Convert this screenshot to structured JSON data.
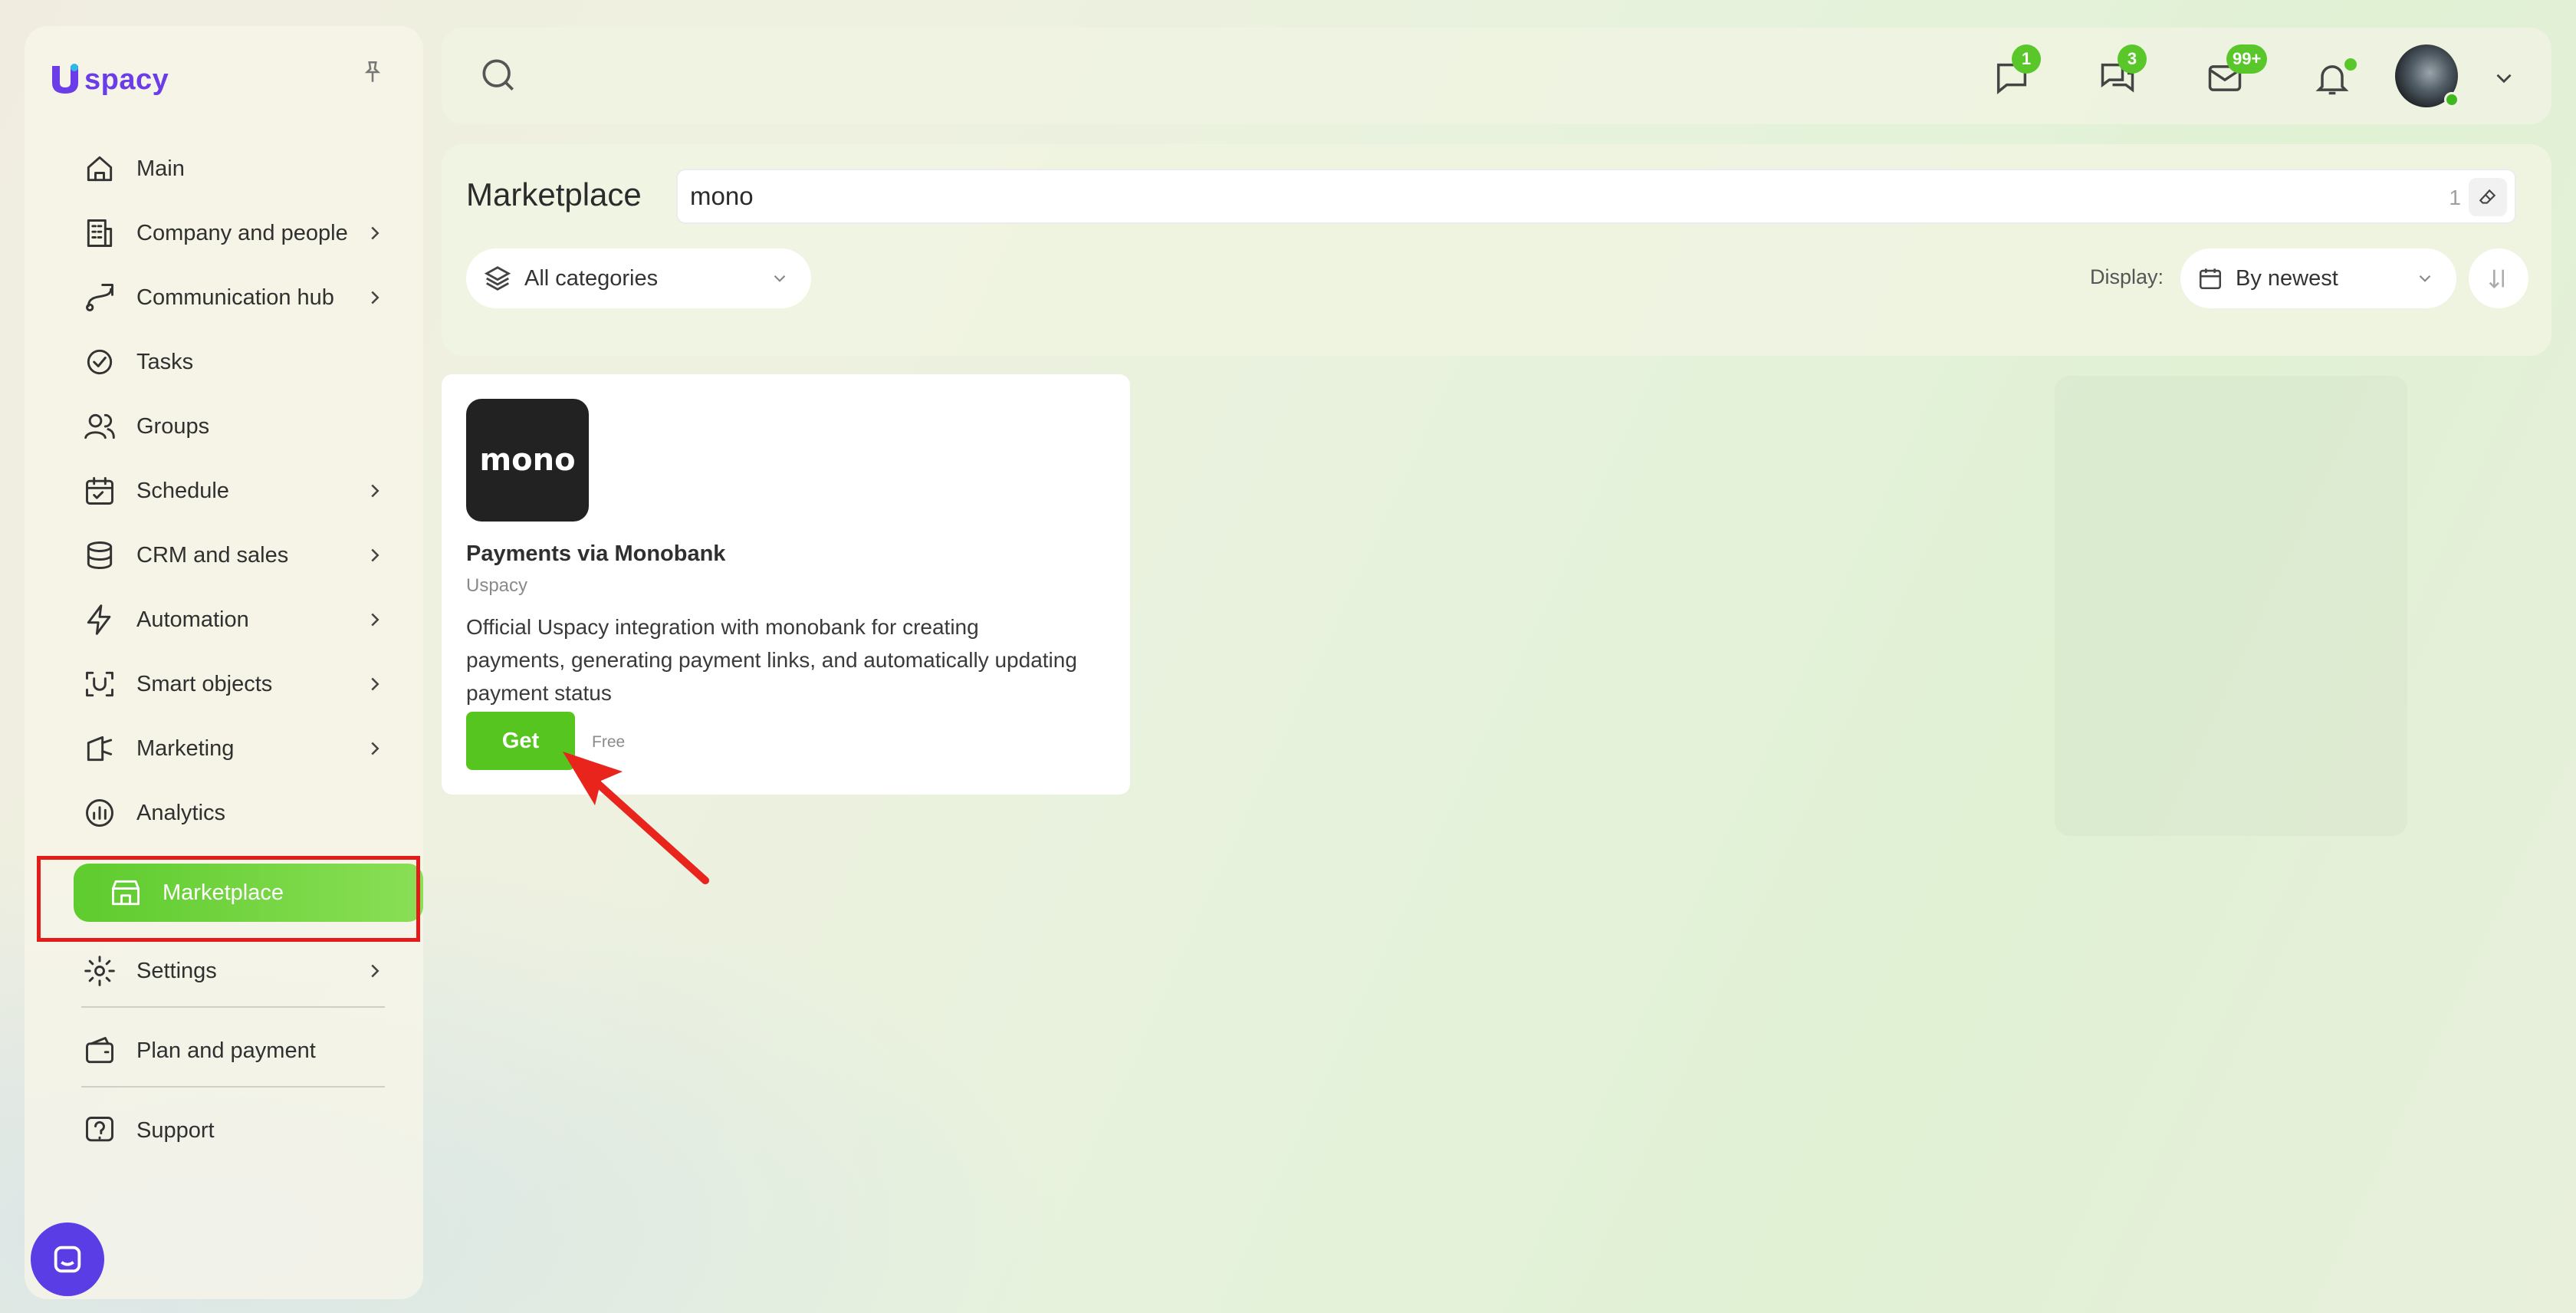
{
  "brand": {
    "name": "spacy",
    "color": "#6a3de8"
  },
  "sidebar": {
    "items": [
      {
        "label": "Main",
        "icon": "home-icon",
        "has_submenu": false
      },
      {
        "label": "Company and people",
        "icon": "building-icon",
        "has_submenu": true
      },
      {
        "label": "Communication hub",
        "icon": "chat-path-icon",
        "has_submenu": true
      },
      {
        "label": "Tasks",
        "icon": "task-check-icon",
        "has_submenu": false
      },
      {
        "label": "Groups",
        "icon": "users-icon",
        "has_submenu": false
      },
      {
        "label": "Schedule",
        "icon": "calendar-icon",
        "has_submenu": true
      },
      {
        "label": "CRM and sales",
        "icon": "database-icon",
        "has_submenu": true
      },
      {
        "label": "Automation",
        "icon": "lightning-icon",
        "has_submenu": true
      },
      {
        "label": "Smart objects",
        "icon": "scan-icon",
        "has_submenu": true
      },
      {
        "label": "Marketing",
        "icon": "marketing-icon",
        "has_submenu": true
      },
      {
        "label": "Analytics",
        "icon": "analytics-icon",
        "has_submenu": false
      },
      {
        "label": "Marketplace",
        "icon": "store-icon",
        "has_submenu": false,
        "active": true
      },
      {
        "label": "Settings",
        "icon": "gear-icon",
        "has_submenu": true
      },
      {
        "label": "Plan and payment",
        "icon": "wallet-icon",
        "has_submenu": false
      },
      {
        "label": "Support",
        "icon": "help-icon",
        "has_submenu": false
      }
    ]
  },
  "topbar": {
    "messages_badge": "1",
    "chats_badge": "3",
    "mail_badge": "99+"
  },
  "page": {
    "title": "Marketplace",
    "search_value": "mono",
    "search_count": "1",
    "category_filter": "All categories",
    "display_label": "Display:",
    "sort_value": "By newest"
  },
  "apps": [
    {
      "logo_text": "mono",
      "name": "Payments via Monobank",
      "vendor": "Uspacy",
      "description": "Official Uspacy integration with monobank for creating payments, generating payment links, and automatically updating payment status",
      "action": "Get",
      "price": "Free"
    }
  ],
  "colors": {
    "accent": "#57c51f",
    "highlight": "#e31b1b",
    "chat_widget": "#5b3de6"
  }
}
